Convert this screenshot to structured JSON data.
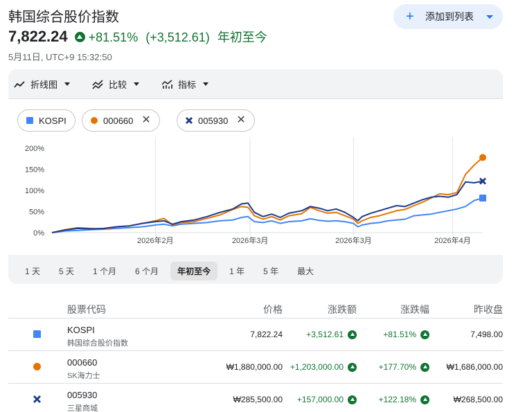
{
  "header": {
    "title": "韩国综合股价指数",
    "add_button_label": "添加到列表",
    "price": "7,822.24",
    "change_pct": "+81.51%",
    "change_abs": "(+3,512.61)",
    "period": "年初至今",
    "timestamp": "5月11日, UTC+9 15:32:50"
  },
  "toolbar": {
    "chart_type_label": "折线图",
    "compare_label": "比较",
    "indicators_label": "指标"
  },
  "chips": [
    {
      "label": "KOSPI",
      "marker": "square",
      "color": "#4285f4",
      "removable": false
    },
    {
      "label": "000660",
      "marker": "circle",
      "color": "#e37400",
      "removable": true
    },
    {
      "label": "005930",
      "marker": "cross",
      "color": "#1a3a8a",
      "removable": true
    }
  ],
  "ranges": [
    {
      "label": "1 天",
      "active": false
    },
    {
      "label": "5 天",
      "active": false
    },
    {
      "label": "1 个月",
      "active": false
    },
    {
      "label": "6 个月",
      "active": false
    },
    {
      "label": "年初至今",
      "active": true
    },
    {
      "label": "1 年",
      "active": false
    },
    {
      "label": "5 年",
      "active": false
    },
    {
      "label": "最大",
      "active": false
    }
  ],
  "table": {
    "headers": [
      "股票代码",
      "价格",
      "涨跌额",
      "涨跌幅",
      "昨收盘"
    ],
    "rows": [
      {
        "symbol": "KOSPI",
        "name": "韩国综合股价指数",
        "price": "7,822.24",
        "change": "+3,512.61",
        "pct": "+81.51%",
        "prev": "7,498.00",
        "marker": "square",
        "color": "#4285f4"
      },
      {
        "symbol": "000660",
        "name": "SK海力士",
        "price": "₩1,880,000.00",
        "change": "+1,203,000.00",
        "pct": "+177.70%",
        "prev": "₩1,686,000.00",
        "marker": "circle",
        "color": "#e37400"
      },
      {
        "symbol": "005930",
        "name": "三星商城",
        "price": "₩285,500.00",
        "change": "+157,000.00",
        "pct": "+122.18%",
        "prev": "₩268,500.00",
        "marker": "cross",
        "color": "#1a3a8a"
      }
    ]
  },
  "chart_data": {
    "type": "line",
    "y_tick_labels": [
      "200%",
      "150%",
      "100%",
      "50%",
      "0%"
    ],
    "y_ticks": [
      200,
      150,
      100,
      50,
      0
    ],
    "ylim": [
      0,
      200
    ],
    "x_tick_labels": [
      "2026年2月",
      "2026年3月",
      "2026年3月",
      "2026年4月"
    ],
    "x_tick_positions": [
      0.24,
      0.46,
      0.7,
      0.93
    ],
    "grid": true,
    "series": [
      {
        "name": "KOSPI",
        "color": "#4285f4",
        "end_marker": "square",
        "x": [
          0,
          0.03,
          0.06,
          0.09,
          0.12,
          0.15,
          0.18,
          0.21,
          0.24,
          0.26,
          0.28,
          0.3,
          0.33,
          0.36,
          0.39,
          0.42,
          0.44,
          0.455,
          0.47,
          0.49,
          0.51,
          0.53,
          0.55,
          0.58,
          0.6,
          0.62,
          0.64,
          0.66,
          0.68,
          0.7,
          0.71,
          0.72,
          0.74,
          0.76,
          0.78,
          0.8,
          0.82,
          0.84,
          0.86,
          0.88,
          0.9,
          0.92,
          0.94,
          0.96,
          0.98,
          1.0
        ],
        "values": [
          0,
          4,
          5,
          7,
          8,
          10,
          12,
          14,
          18,
          20,
          16,
          20,
          22,
          24,
          28,
          30,
          36,
          38,
          26,
          24,
          28,
          22,
          26,
          28,
          33,
          29,
          27,
          28,
          26,
          22,
          14,
          18,
          22,
          24,
          28,
          30,
          32,
          40,
          42,
          44,
          48,
          52,
          56,
          62,
          76,
          82
        ]
      },
      {
        "name": "000660",
        "color": "#e37400",
        "end_marker": "circle",
        "x": [
          0,
          0.03,
          0.06,
          0.09,
          0.12,
          0.15,
          0.18,
          0.21,
          0.24,
          0.26,
          0.28,
          0.3,
          0.33,
          0.36,
          0.39,
          0.42,
          0.44,
          0.455,
          0.47,
          0.49,
          0.51,
          0.53,
          0.55,
          0.58,
          0.6,
          0.62,
          0.64,
          0.66,
          0.68,
          0.7,
          0.71,
          0.72,
          0.74,
          0.76,
          0.78,
          0.8,
          0.82,
          0.84,
          0.86,
          0.88,
          0.9,
          0.92,
          0.94,
          0.96,
          0.98,
          1.0
        ],
        "values": [
          0,
          7,
          12,
          10,
          8,
          14,
          16,
          22,
          28,
          34,
          18,
          24,
          26,
          34,
          42,
          55,
          62,
          60,
          40,
          32,
          38,
          30,
          40,
          45,
          60,
          52,
          46,
          48,
          40,
          32,
          22,
          28,
          36,
          40,
          46,
          52,
          55,
          64,
          72,
          82,
          92,
          90,
          95,
          138,
          160,
          178
        ]
      },
      {
        "name": "005930",
        "color": "#1a3a8a",
        "end_marker": "cross",
        "x": [
          0,
          0.03,
          0.06,
          0.09,
          0.12,
          0.15,
          0.18,
          0.21,
          0.24,
          0.26,
          0.28,
          0.3,
          0.33,
          0.36,
          0.39,
          0.42,
          0.44,
          0.455,
          0.47,
          0.49,
          0.51,
          0.53,
          0.55,
          0.58,
          0.6,
          0.62,
          0.64,
          0.66,
          0.68,
          0.7,
          0.71,
          0.72,
          0.74,
          0.76,
          0.78,
          0.8,
          0.82,
          0.84,
          0.86,
          0.88,
          0.9,
          0.92,
          0.94,
          0.96,
          0.98,
          1.0
        ],
        "values": [
          0,
          6,
          10,
          9,
          10,
          14,
          16,
          22,
          26,
          28,
          20,
          26,
          30,
          38,
          48,
          56,
          68,
          70,
          48,
          38,
          44,
          36,
          46,
          52,
          62,
          58,
          52,
          56,
          48,
          36,
          28,
          38,
          46,
          52,
          58,
          64,
          62,
          70,
          78,
          84,
          86,
          84,
          90,
          120,
          118,
          122
        ]
      }
    ]
  }
}
